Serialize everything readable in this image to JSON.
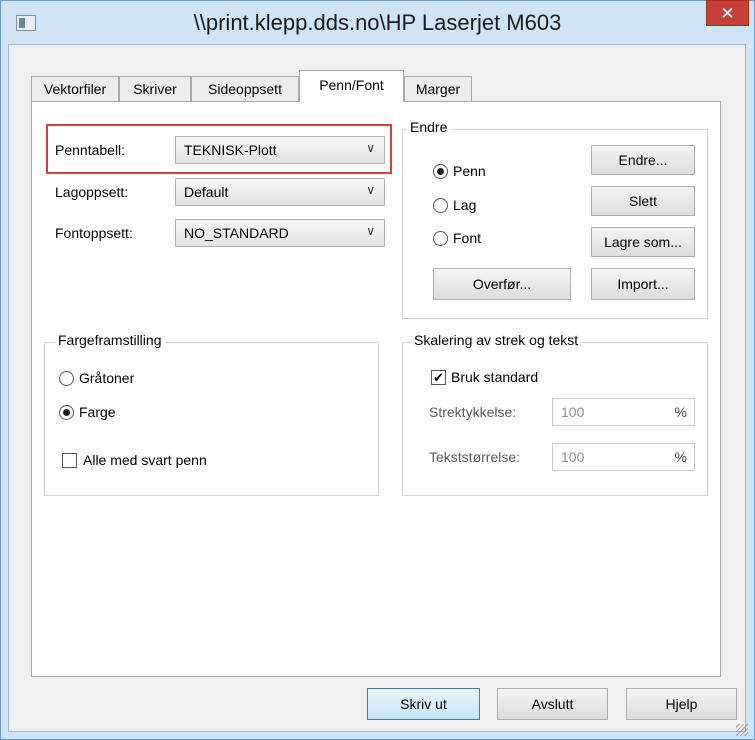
{
  "window": {
    "title": "\\\\print.klepp.dds.no\\HP Laserjet M603",
    "close_glyph": "✕"
  },
  "tabs": [
    {
      "label": "Vektorfiler"
    },
    {
      "label": "Skriver"
    },
    {
      "label": "Sideoppsett"
    },
    {
      "label": "Penn/Font"
    },
    {
      "label": "Marger"
    }
  ],
  "active_tab": "Penn/Font",
  "settings": {
    "penntabell": {
      "label": "Penntabell:",
      "value": "TEKNISK-Plott"
    },
    "lagoppsett": {
      "label": "Lagoppsett:",
      "value": "Default"
    },
    "fontoppsett": {
      "label": "Fontoppsett:",
      "value": "NO_STANDARD"
    },
    "dropdown_glyph": "∨"
  },
  "endre": {
    "legend": "Endre",
    "radios": [
      {
        "label": "Penn",
        "checked": true
      },
      {
        "label": "Lag",
        "checked": false
      },
      {
        "label": "Font",
        "checked": false
      }
    ],
    "buttons": {
      "endre": "Endre...",
      "slett": "Slett",
      "lagre_som": "Lagre som...",
      "overfor": "Overfør...",
      "import": "Import..."
    }
  },
  "fargeframstilling": {
    "legend": "Fargeframstilling",
    "radios": [
      {
        "label": "Gråtoner",
        "checked": false
      },
      {
        "label": "Farge",
        "checked": true
      }
    ],
    "checkbox": {
      "label": "Alle med svart penn",
      "checked": false
    }
  },
  "skalering": {
    "legend": "Skalering av strek og tekst",
    "checkbox": {
      "label": "Bruk standard",
      "checked": true,
      "mark": "✔"
    },
    "strektykkelse": {
      "label": "Strektykkelse:",
      "value": "100",
      "unit": "%"
    },
    "tekststorrelse": {
      "label": "Tekststørrelse:",
      "value": "100",
      "unit": "%"
    }
  },
  "footer": {
    "skriv_ut": "Skriv ut",
    "avslutt": "Avslutt",
    "hjelp": "Hjelp"
  },
  "colors": {
    "title_bar": "#cfe4f6",
    "close_button": "#c7403a",
    "highlight_border": "#e03a3a"
  }
}
